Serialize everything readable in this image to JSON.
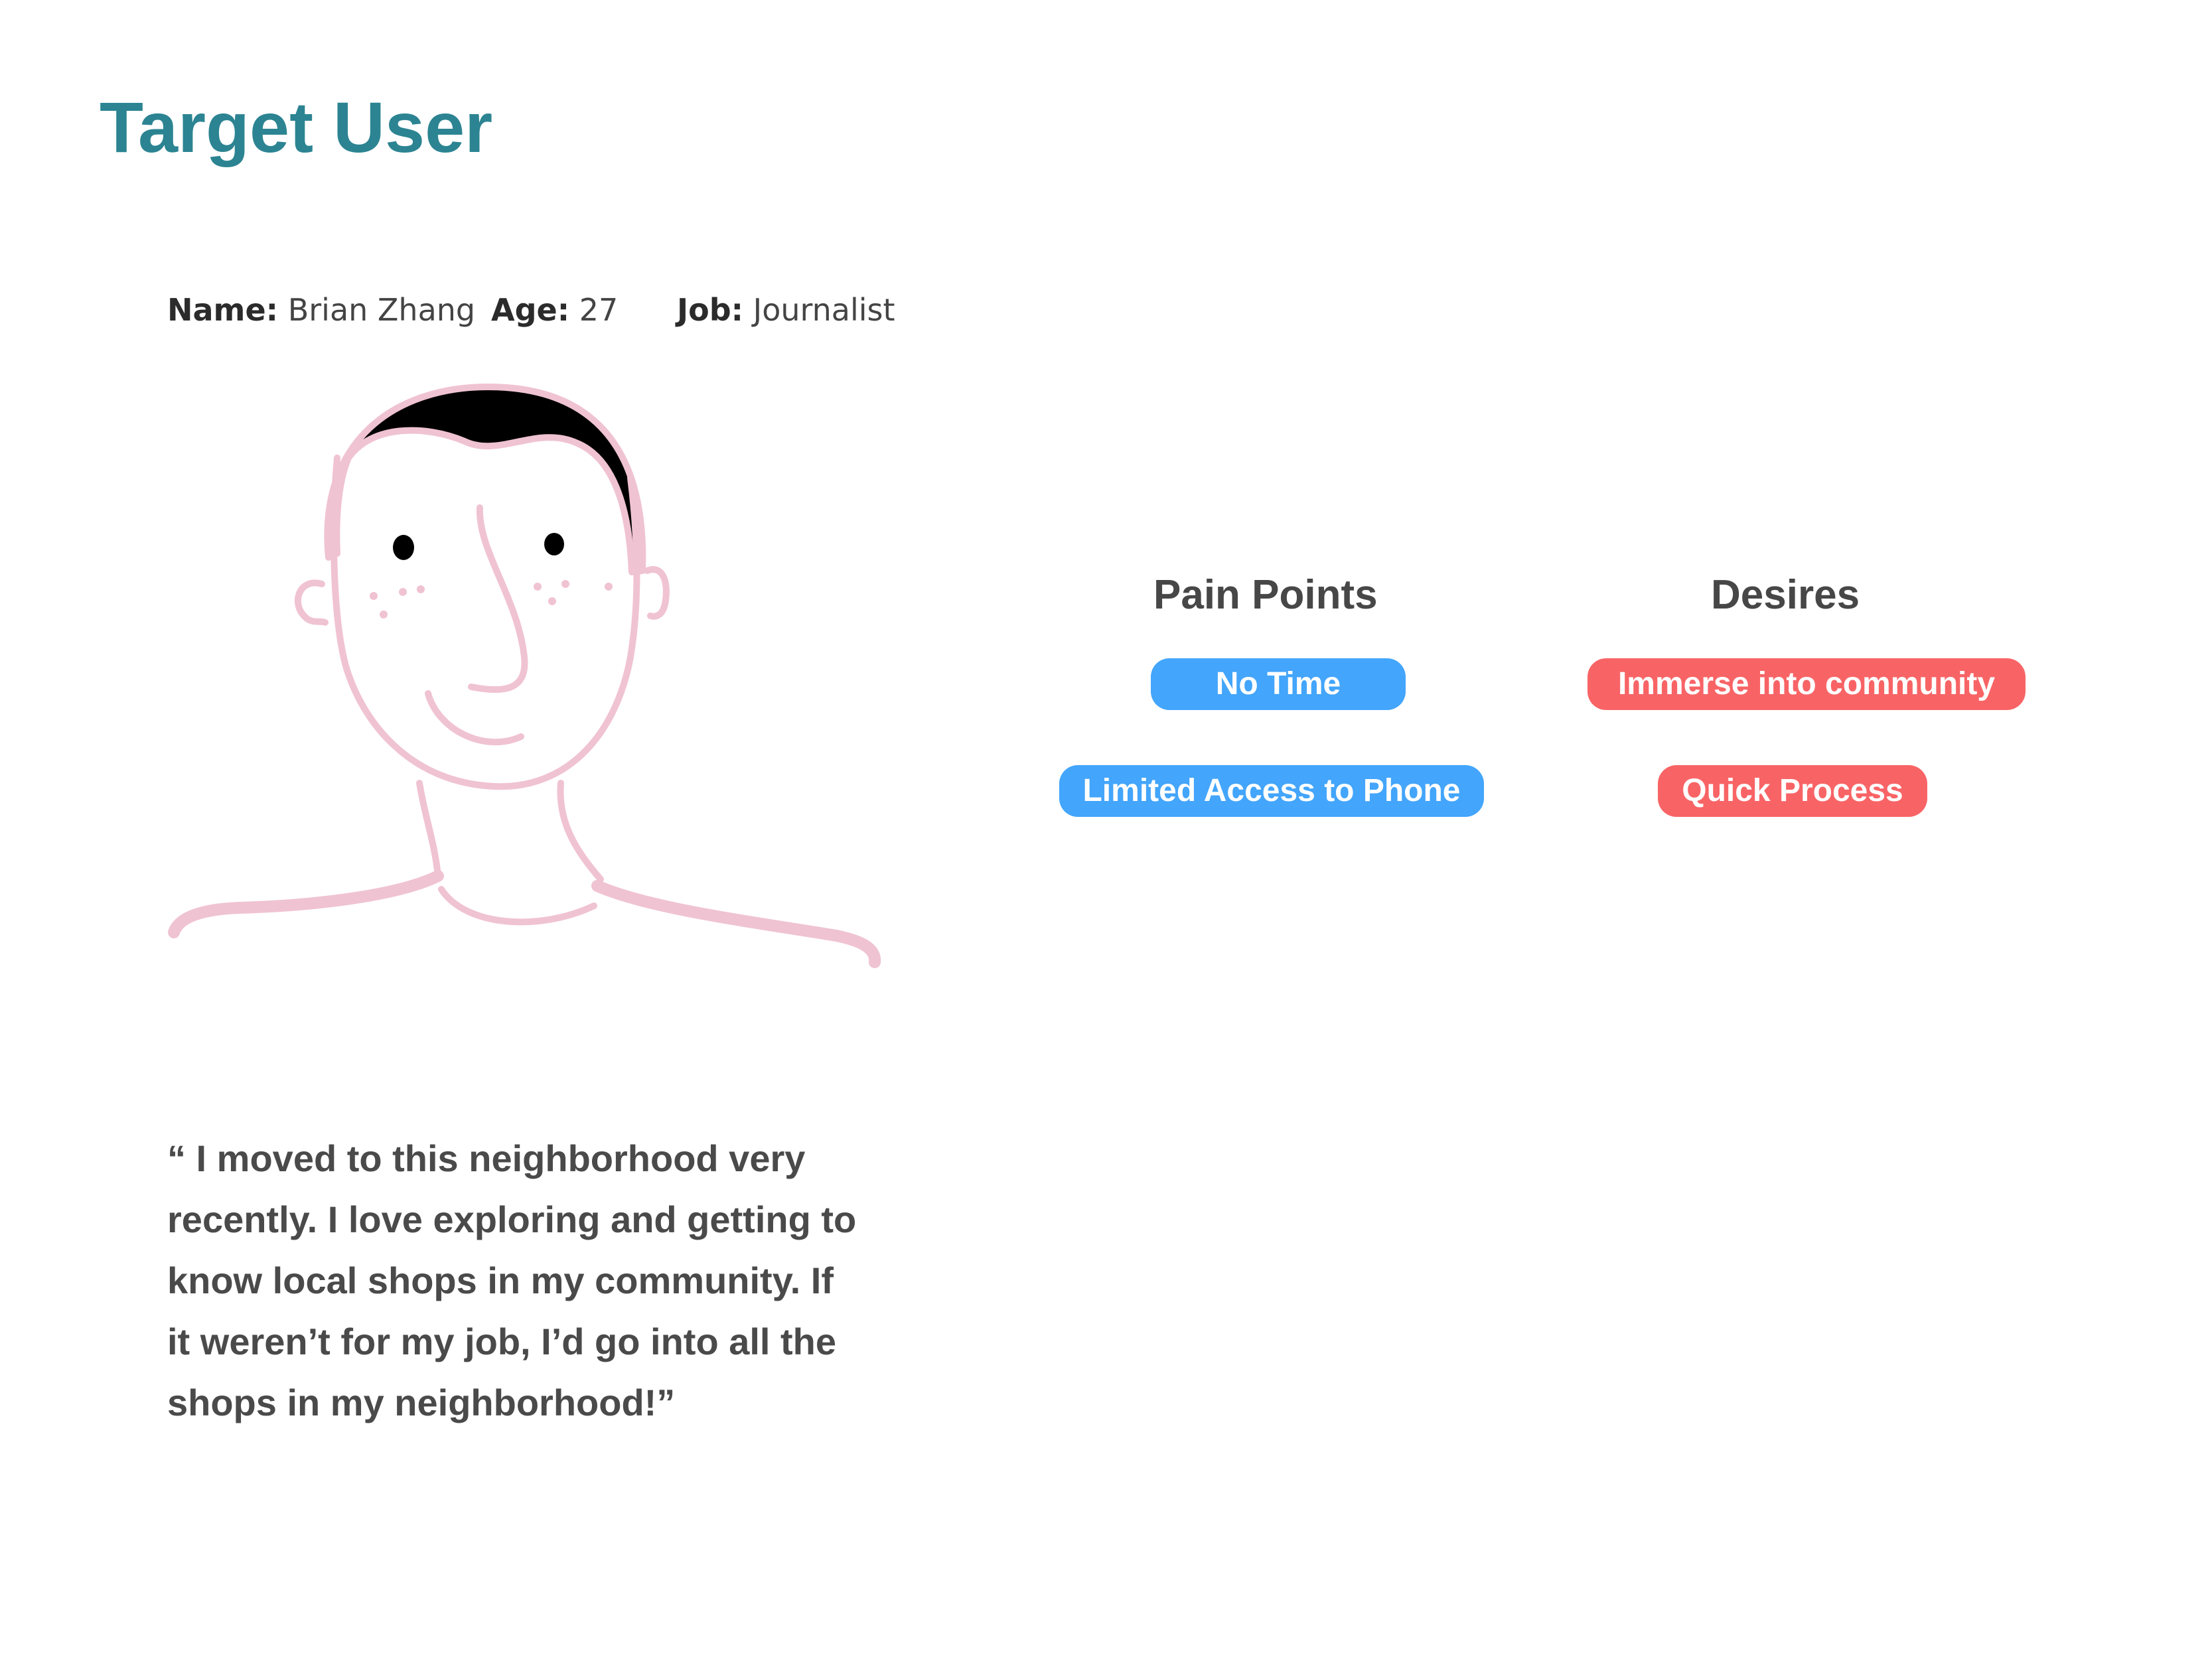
{
  "title": "Target User",
  "persona": {
    "name_label": "Name:",
    "name_value": "Brian Zhang",
    "age_label": "Age:",
    "age_value": "27",
    "job_label": "Job:",
    "job_value": "Journalist"
  },
  "pain_points": {
    "heading": "Pain Points",
    "items": [
      "No Time",
      "Limited Access to Phone"
    ]
  },
  "desires": {
    "heading": "Desires",
    "items": [
      "Immerse into community",
      "Quick Process"
    ]
  },
  "quote": {
    "lines": [
      "“ I moved to this neighborhood very",
      "recently. I love exploring and getting to",
      "know local shops in my community. If",
      "it weren’t for my job, I’d go into all the",
      "shops in my neighborhood!”"
    ]
  },
  "colors": {
    "title": "#2c8492",
    "pain_pill": "#43a5fb",
    "desire_pill": "#f86466",
    "sketch_line": "#f0c3d2",
    "hair": "#000000"
  }
}
